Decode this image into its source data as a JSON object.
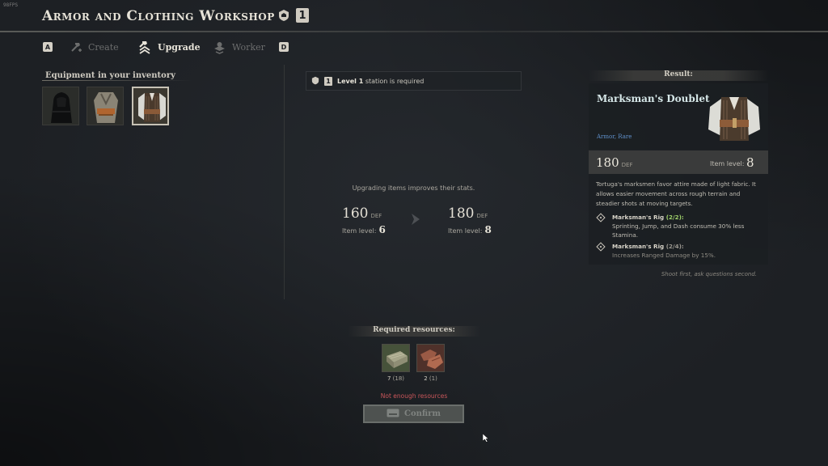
{
  "fps_label": "98FPS",
  "header": {
    "title": "Armor and Clothing Workshop",
    "station_level": "1"
  },
  "tabs": [
    {
      "key": "A"
    },
    {
      "label": "Create",
      "state": "disabled"
    },
    {
      "label": "Upgrade",
      "state": "active"
    },
    {
      "label": "Worker",
      "state": "disabled"
    },
    {
      "key": "D"
    }
  ],
  "inventory": {
    "title": "Equipment in your inventory",
    "slots": [
      {
        "item": "dark hooded armor",
        "selected": false
      },
      {
        "item": "tan vest outfit",
        "selected": false
      },
      {
        "item": "marksman's doublet",
        "selected": true
      }
    ]
  },
  "requirement": {
    "level_badge": "1",
    "level_text": "Level 1",
    "rest_text": "station is required"
  },
  "upgrade": {
    "info": "Upgrading items improves their stats.",
    "current": {
      "def": "160",
      "def_unit": "DEF",
      "level_label": "Item level:",
      "level": "6"
    },
    "next": {
      "def": "180",
      "def_unit": "DEF",
      "level_label": "Item level:",
      "level": "8"
    }
  },
  "result": {
    "header": "Result:",
    "name": "Marksman's Doublet",
    "type": "Armor, Rare",
    "def": "180",
    "def_unit": "DEF",
    "level_label": "Item level:",
    "level": "8",
    "description": "Tortuga's marksmen favor attire made of light fabric. It allows easier movement across rough terrain and steadier shots at moving targets.",
    "perks": [
      {
        "name": "Marksman's Rig",
        "count": "(2/2):",
        "active": true,
        "desc": "Sprinting, Jump, and Dash consume 30% less Stamina."
      },
      {
        "name": "Marksman's Rig",
        "count": "(2/4):",
        "active": false,
        "desc": "Increases Ranged Damage by 15%."
      }
    ],
    "flavor": "Shoot first, ask questions second."
  },
  "resources": {
    "header": "Required resources:",
    "items": [
      {
        "name": "cloth bundle",
        "need": "7",
        "have": "(18)"
      },
      {
        "name": "leather scraps",
        "need": "2",
        "have": "(1)"
      }
    ],
    "warning": "Not enough resources",
    "confirm_label": "Confirm"
  },
  "colors": {
    "background": "#1d2024",
    "accent_text": "#e6e2d7",
    "rare": "#5f8fc9",
    "active_perk": "#9fd06a",
    "warning": "#c9565a",
    "item_name": "#d6e7e8"
  }
}
